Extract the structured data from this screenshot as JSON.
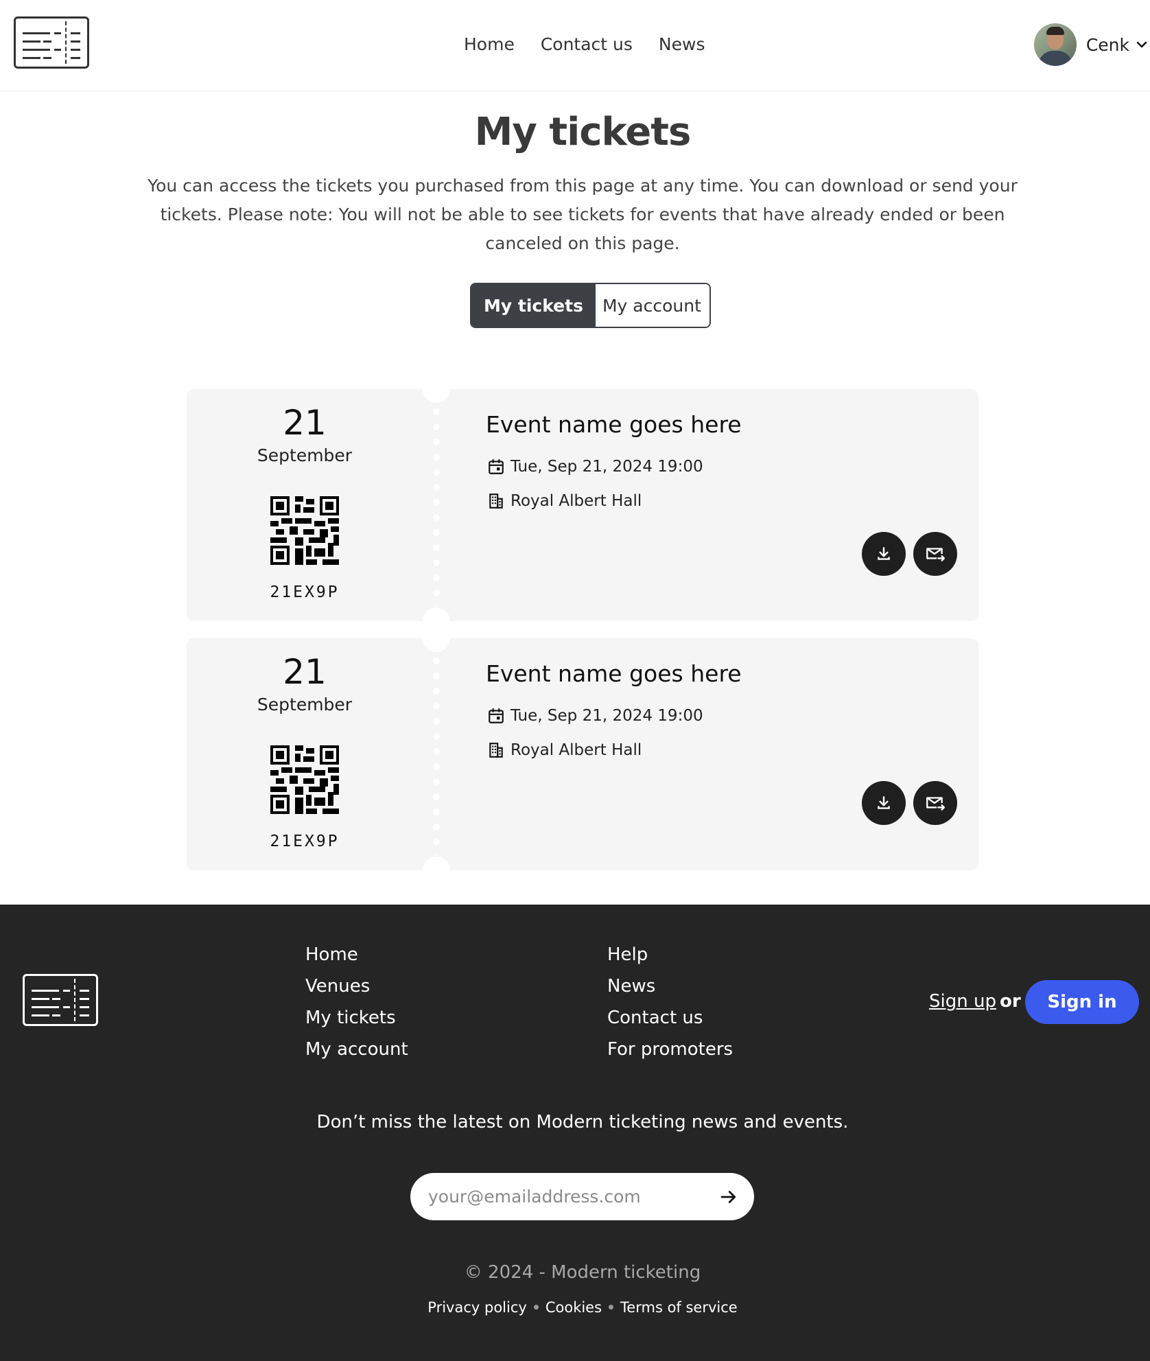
{
  "header": {
    "nav": [
      "Home",
      "Contact us",
      "News"
    ],
    "user_name": "Cenk"
  },
  "page": {
    "title": "My tickets",
    "intro": "You can access the tickets you purchased from this page at any time. You can download or send your tickets. Please note: You will not be able to see tickets for events that have already ended or been canceled on this page.",
    "tabs": [
      "My tickets",
      "My account"
    ],
    "active_tab": "My tickets"
  },
  "tickets": [
    {
      "day": "21",
      "month": "September",
      "code": "21EX9P",
      "event_name": "Event name goes here",
      "datetime": "Tue, Sep 21, 2024 19:00",
      "venue": "Royal Albert Hall"
    },
    {
      "day": "21",
      "month": "September",
      "code": "21EX9P",
      "event_name": "Event name goes here",
      "datetime": "Tue, Sep 21, 2024 19:00",
      "venue": "Royal Albert Hall"
    }
  ],
  "footer": {
    "col1": [
      "Home",
      "Venues",
      "My tickets",
      "My account"
    ],
    "col2": [
      "Help",
      "News",
      "Contact us",
      "For promoters"
    ],
    "signup_label": "Sign up",
    "or_label": "or",
    "signin_label": "Sign in",
    "newsletter_text": "Don’t miss the latest on Modern ticketing news and events.",
    "email_placeholder": "your@emailaddress.com",
    "copyright": "© 2024 - Modern ticketing",
    "legal_links": [
      "Privacy policy",
      "Cookies",
      "Terms of service"
    ]
  },
  "colors": {
    "accent": "#3b5bef",
    "dark": "#252525",
    "toggle_active": "#3d4146",
    "card_bg": "#f5f5f5"
  },
  "icons": {
    "logo": "ticket-logo-icon",
    "chevron": "chevron-down-icon",
    "calendar": "calendar-icon",
    "venue": "building-icon",
    "download": "download-icon",
    "mail": "mail-send-icon",
    "submit": "arrow-right-icon"
  }
}
